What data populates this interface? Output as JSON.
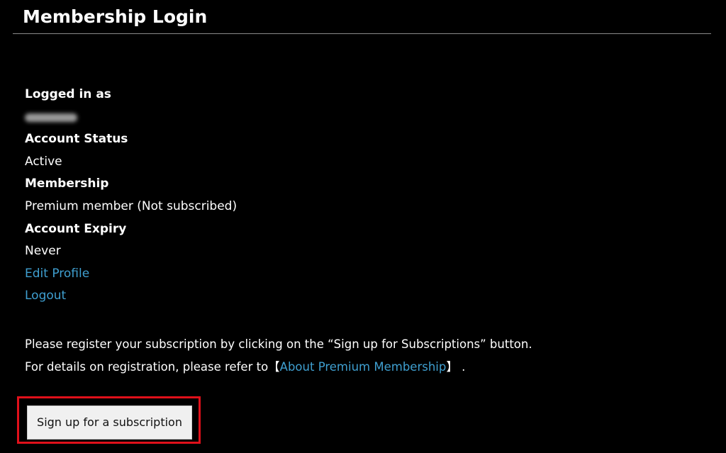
{
  "header": {
    "title": "Membership Login"
  },
  "account": {
    "logged_in_label": "Logged in as",
    "account_status_label": "Account Status",
    "account_status_value": "Active",
    "membership_label": "Membership",
    "membership_value": "Premium member (Not subscribed)",
    "account_expiry_label": "Account Expiry",
    "account_expiry_value": "Never"
  },
  "links": {
    "edit_profile": "Edit Profile",
    "logout": "Logout"
  },
  "notice": {
    "line1": "Please register your subscription by clicking on the “Sign up for Subscriptions” button.",
    "line2_prefix": "For details on registration, please refer to",
    "bracket_open": "【",
    "premium_link": "About Premium Membership",
    "bracket_close": "】",
    "line2_suffix": " ."
  },
  "cta": {
    "label": "Sign up for a subscription"
  },
  "colors": {
    "background": "#000000",
    "link": "#3f9fd0",
    "highlight_border": "#e0101a",
    "button_bg": "#f0f0f0"
  }
}
